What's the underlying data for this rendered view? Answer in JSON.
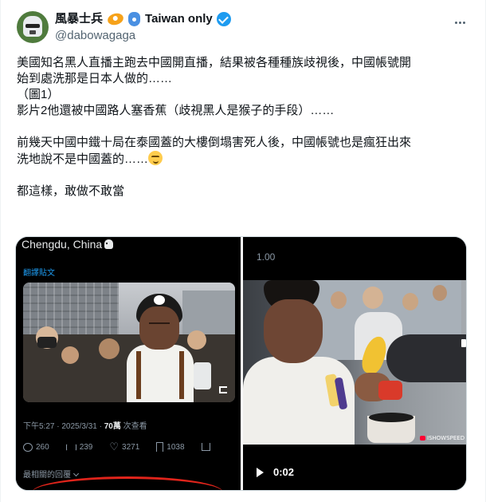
{
  "author": {
    "display_name": "風暴士兵",
    "name_suffix": "Taiwan only",
    "handle": "@dabowagaga",
    "emoji_icons": [
      "eye-of-horus-icon",
      "hamsa-icon"
    ],
    "verified": true
  },
  "tweet": {
    "lines": [
      "美國知名黑人直播主跑去中國開直播，結果被各種種族歧視後，中國帳號開",
      "始到處洗那是日本人做的……",
      "（圖1）",
      "影片2他還被中國路人塞香蕉（歧視黑人是猴子的手段）……",
      "",
      "前幾天中國中鐵十局在泰國蓋的大樓倒塌害死人後，中國帳號也是瘋狂出來",
      "洗地說不是中國蓋的……",
      "",
      "都這樣，敢做不敢當"
    ],
    "emoji": "smirk-face-icon"
  },
  "media_left": {
    "location_text": "Chengdu, China",
    "location_icon": "skull-icon",
    "translate_label": "翻譯貼文",
    "timestamp": "下午5:27 · 2025/3/31 · ",
    "views_count": "70萬",
    "views_label": " 次查看",
    "stats": {
      "replies": "260",
      "reposts": "239",
      "likes": "3271",
      "bookmarks": "1038"
    },
    "related_label": "最相關的回覆"
  },
  "media_right": {
    "speed_label": "1.00",
    "watermark": "ISHOWSPEED",
    "time_label": "0:02"
  },
  "colors": {
    "accent": "#1d9bf0",
    "text": "#0f1419",
    "muted": "#536471",
    "annotation_red": "#e0241b"
  }
}
